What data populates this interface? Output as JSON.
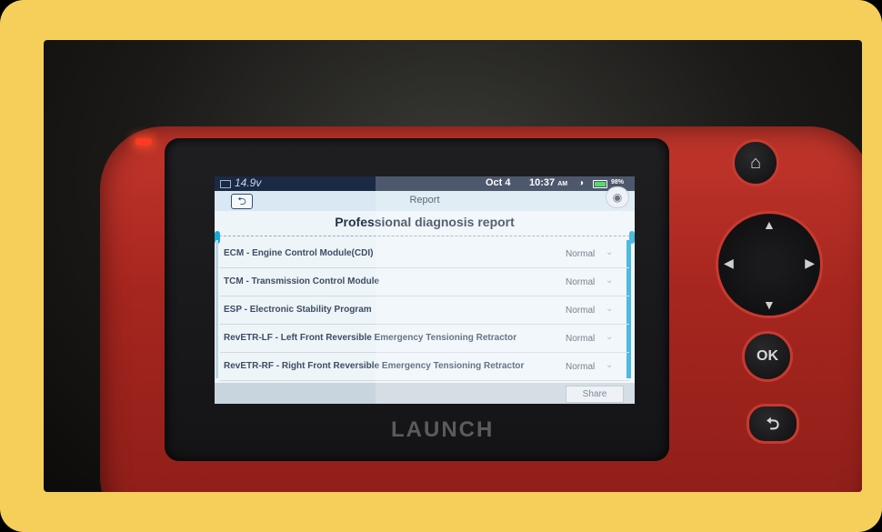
{
  "device": {
    "brand": "LAUNCH"
  },
  "status_bar": {
    "voltage": "14.9v",
    "date": "Oct 4",
    "time": "10:37",
    "ampm": "AM",
    "battery_percent": "98%",
    "battery_level": 0.98
  },
  "title_bar": {
    "title": "Report",
    "back_icon": "back-arrow-icon",
    "camera_icon": "camera-icon"
  },
  "report": {
    "heading": "Professional diagnosis report",
    "rows": [
      {
        "label": "ECM - Engine Control Module(CDI)",
        "status": "Normal"
      },
      {
        "label": "TCM - Transmission Control Module",
        "status": "Normal"
      },
      {
        "label": "ESP - Electronic Stability Program",
        "status": "Normal"
      },
      {
        "label": "RevETR-LF - Left Front Reversible Emergency Tensioning Retractor",
        "status": "Normal"
      },
      {
        "label": "RevETR-RF - Right Front Reversible Emergency Tensioning Retractor",
        "status": "Normal"
      }
    ]
  },
  "footer": {
    "share_label": "Share"
  },
  "hardware_buttons": {
    "home_icon": "home-icon",
    "ok_label": "OK",
    "return_icon": "return-icon"
  },
  "colors": {
    "frame": "#f5cf5a",
    "device_body": "#b02a22",
    "accent": "#1ba7d8",
    "status_bar": "#1b2a44"
  }
}
